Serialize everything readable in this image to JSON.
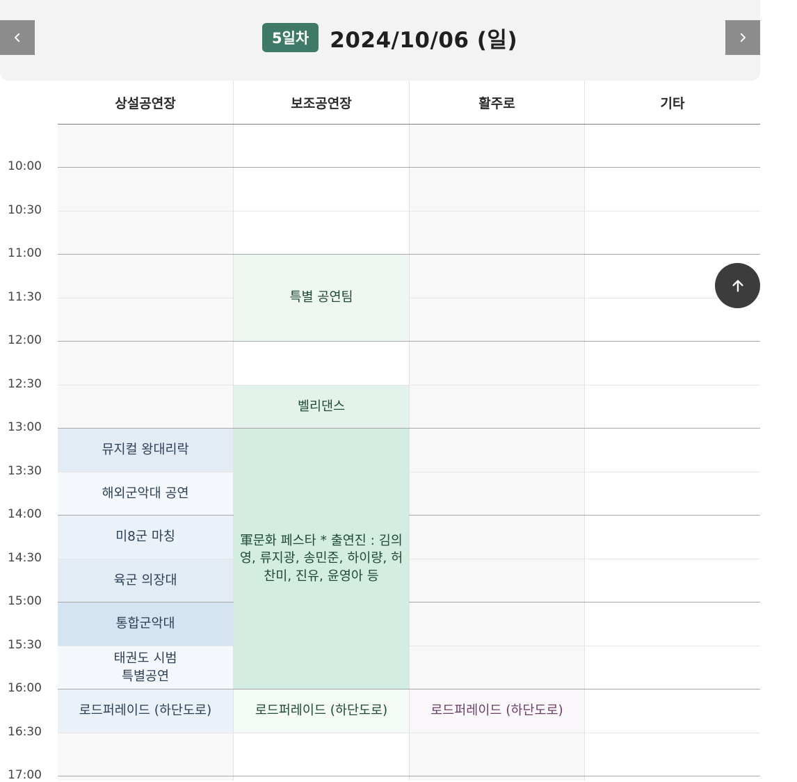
{
  "header": {
    "day_badge": "5일차",
    "date": "2024/10/06 (일)",
    "prev_icon": "chevron-left-icon",
    "next_icon": "chevron-right-icon"
  },
  "venues": [
    "상설공연장",
    "보조공연장",
    "활주로",
    "기타"
  ],
  "times": [
    "10:00",
    "10:30",
    "11:00",
    "11:30",
    "12:00",
    "12:30",
    "13:00",
    "13:30",
    "14:00",
    "14:30",
    "15:00",
    "15:30",
    "16:00",
    "16:30",
    "17:00"
  ],
  "events": {
    "special_team": "특별 공연팀",
    "belly_dance": "벨리댄스",
    "musical": "뮤지컬 왕대리락",
    "overseas_band": "해외군악대 공연",
    "us8_marching": "미8군 마칭",
    "army_honor_guard": "육군 의장대",
    "joint_band": "통합군악대",
    "taekwondo": "태권도 시범\n특별공연",
    "military_festa": "軍문화 페스타 * 출연진 : 김의영, 류지광, 송민준, 하이량, 허찬미, 진유, 윤영아 등",
    "road_parade_1": "로드퍼레이드 (하단도로)",
    "road_parade_2": "로드퍼레이드 (하단도로)",
    "road_parade_3": "로드퍼레이드 (하단도로)"
  },
  "colors": {
    "badge": "#3f7a69",
    "blue_event_1": "#e3ebf4",
    "blue_event_2": "#f4f7fb",
    "blue_event_3": "#d5e4f2",
    "green_event_1": "#eef7f2",
    "green_event_2": "#e3f3eb",
    "green_event_3": "#d4ede2",
    "text_blue": "#2b3f55",
    "text_green": "#1f4a33",
    "text_purple": "#6b3f66"
  },
  "scroll_top_icon": "arrow-up-icon"
}
